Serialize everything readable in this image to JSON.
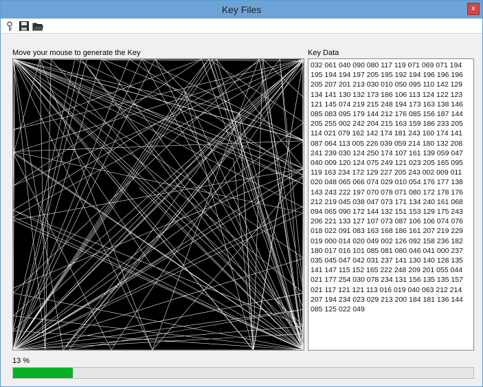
{
  "window": {
    "title": "Key Files",
    "close_label": "x"
  },
  "toolbar": {
    "items": [
      {
        "icon": "key-icon"
      },
      {
        "icon": "save-icon"
      },
      {
        "icon": "open-folder-icon"
      }
    ]
  },
  "canvas": {
    "label": "Move your mouse to generate the Key"
  },
  "key_data": {
    "label": "Key Data",
    "text": "032 061 040 090 080 117 119 071 069 071 194 195 194 194 197 205 195 192 194 196 196 196 205 207 201 213 030 010 050 095 110 142 129 134 141 130 132 173 186 106 113 124 122 123 121 145 074 219 215 248 194 173 163 138 146 085 083 095 179 144 212 176 085 156 187 144 205 255 002 242 204 215 163 159 186 233 205 114 021 079 162 142 174 181 243 160 174 141 087 064 113 005 226 039 059 214 180 132 208 241 239 030 124 250 174 107 161 139 059 047 040 009 120 124 075 249 121 023 205 165 095 119 163 234 172 129 227 205 243 002 009 011 020 048 065 066 074 029 010 054 176 177 138 143 243 222 197 070 078 071 080 172 178 176 212 219 045 038 047 073 171 134 240 161 068 094 065 090 172 144 132 151 153 129 175 243 206 221 133 127 107 073 087 106 106 074 076 018 022 091 083 163 168 186 161 207 219 229 019 000 014 020 049 002 126 092 158 236 182 180 017 016 101 085 081 080 046 041 000 237 035 045 047 042 031 237 141 130 140 128 135 141 147 115 152 165 222 248 209 201 055 044 021 177 254 030 078 234 131 156 135 135 157 021 117 121 121 113 016 019 040 063 212 214 207 194 234 023 029 213 200 184 181 136 144 085 125 022 049"
  },
  "progress": {
    "label": "13 %",
    "value": 0.13,
    "color": "#06b025"
  }
}
